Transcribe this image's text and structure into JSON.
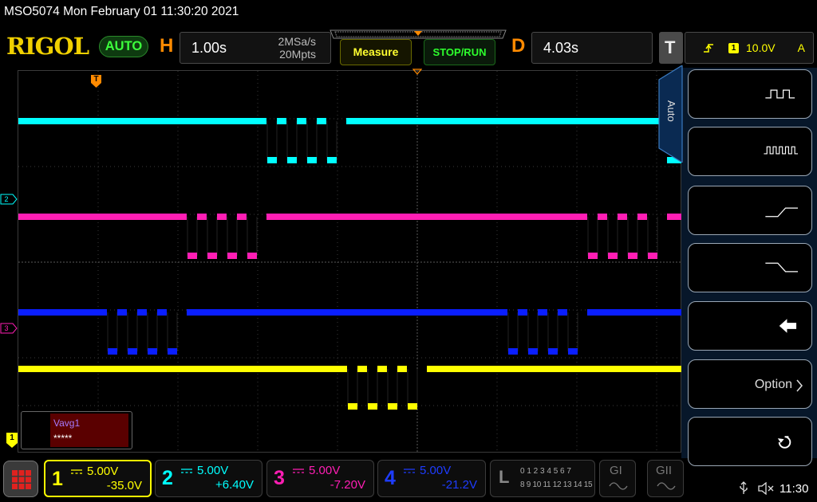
{
  "header": {
    "title": "MSO5074  Mon February 01 11:30:20 2021",
    "brand": "RIGOL",
    "mode": "AUTO"
  },
  "horizontal": {
    "letter": "H",
    "timebase": "1.00s",
    "sample_rate": "2MSa/s",
    "memory_depth": "20Mpts"
  },
  "buttons": {
    "measure": "Measure",
    "stop_run": "STOP/RUN"
  },
  "delay": {
    "letter": "D",
    "value": "4.03s"
  },
  "trigger": {
    "letter": "T",
    "source": "1",
    "level": "10.0V",
    "sweep": "A"
  },
  "markers": {
    "trigger_pos": "T",
    "ch2": "2",
    "ch3": "3",
    "ch1": "1"
  },
  "measurement": {
    "label": "Vavg1",
    "value": "*****"
  },
  "side_menu": {
    "tab": "Auto",
    "option_label": "Option"
  },
  "channels": [
    {
      "number": "1",
      "scale": "5.00V",
      "offset": "-35.0V",
      "color": "#ffff00"
    },
    {
      "number": "2",
      "scale": "5.00V",
      "offset": "+6.40V",
      "color": "#00ffff"
    },
    {
      "number": "3",
      "scale": "5.00V",
      "offset": "-7.20V",
      "color": "#ff1eb4"
    },
    {
      "number": "4",
      "scale": "5.00V",
      "offset": "-21.2V",
      "color": "#0a1eff"
    }
  ],
  "logic": {
    "letter": "L",
    "row1": "0 1 2 3  4 5 6 7",
    "row2": "8 9 10 11 12 13 14 15"
  },
  "gi": {
    "label": "GI"
  },
  "gii": {
    "label": "GII"
  },
  "status": {
    "time": "11:30"
  }
}
